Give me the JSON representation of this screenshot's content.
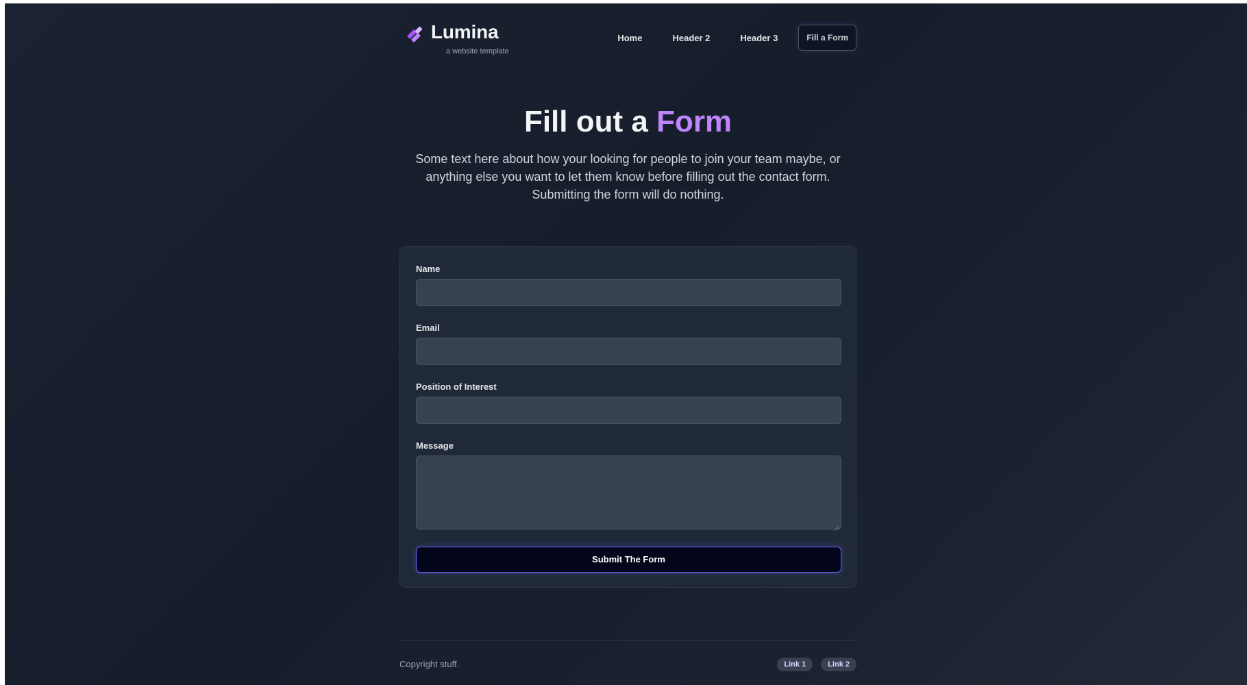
{
  "brand": {
    "name": "Lumina",
    "tagline": "a website template",
    "logo_icon": "diagonal-stripes-logo-icon",
    "accent_color": "#c084fc"
  },
  "nav": {
    "items": [
      {
        "label": "Home"
      },
      {
        "label": "Header 2"
      },
      {
        "label": "Header 3"
      }
    ],
    "cta_label": "Fill a Form"
  },
  "hero": {
    "title_prefix": "Fill out a",
    "title_accent": "Form",
    "description": "Some text here about how your looking for people to join your team maybe, or anything else you want to let them know before filling out the contact form. Submitting the form will do nothing."
  },
  "form": {
    "fields": [
      {
        "label": "Name",
        "value": "",
        "placeholder": ""
      },
      {
        "label": "Email",
        "value": "",
        "placeholder": ""
      },
      {
        "label": "Position of Interest",
        "value": "",
        "placeholder": ""
      },
      {
        "label": "Message",
        "value": "",
        "placeholder": ""
      }
    ],
    "submit_label": "Submit The Form"
  },
  "footer": {
    "copyright": "Copyright stuff.",
    "links": [
      {
        "label": "Link 1"
      },
      {
        "label": "Link 2"
      }
    ]
  },
  "colors": {
    "background": "#1a2231",
    "card": "#202938",
    "input": "#374151",
    "accent": "#c084fc",
    "button_border": "#6366f1"
  }
}
